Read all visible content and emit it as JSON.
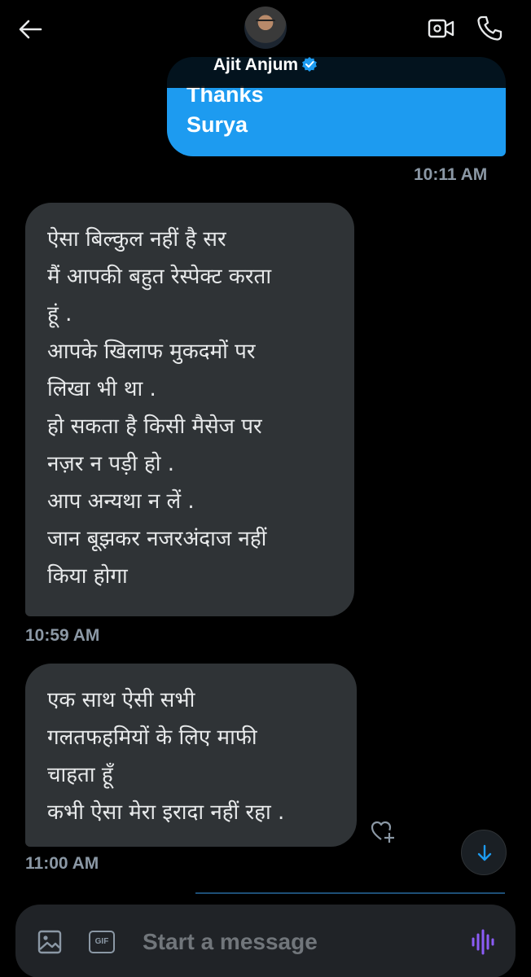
{
  "header": {
    "contact_name": "Ajit Anjum",
    "verified": true
  },
  "messages": [
    {
      "direction": "sent",
      "text": "Thanks\nSurya",
      "time": "10:11 AM"
    },
    {
      "direction": "received",
      "text": "ऐसा बिल्कुल नहीं है सर\nमैं आपकी बहुत रेस्पेक्ट करता\nहूं .\nआपके खिलाफ मुकदमों पर\nलिखा भी था .\nहो सकता है किसी मैसेज पर\nनज़र न पड़ी हो .\nआप अन्यथा न लें .\nजान बूझकर नजरअंदाज नहीं\nकिया होगा",
      "time": "10:59 AM"
    },
    {
      "direction": "received",
      "text": "एक साथ ऐसी सभी\nगलतफहमियों के लिए माफी\nचाहता हूँ\nकभी ऐसा मेरा इरादा नहीं रहा .",
      "time": "11:00 AM"
    }
  ],
  "composer": {
    "placeholder": "Start a message",
    "gif_label": "GIF"
  },
  "icons": {
    "back": "arrow-left-icon",
    "video": "video-camera-icon",
    "call": "phone-icon",
    "react": "heart-plus-icon",
    "scroll": "arrow-down-icon",
    "media": "image-icon",
    "voice": "voice-wave-icon"
  },
  "colors": {
    "accent": "#1d9bf0",
    "received_bubble": "#2f3336",
    "muted_text": "#8b98a5",
    "voice_accent": "#8b5cf6"
  }
}
